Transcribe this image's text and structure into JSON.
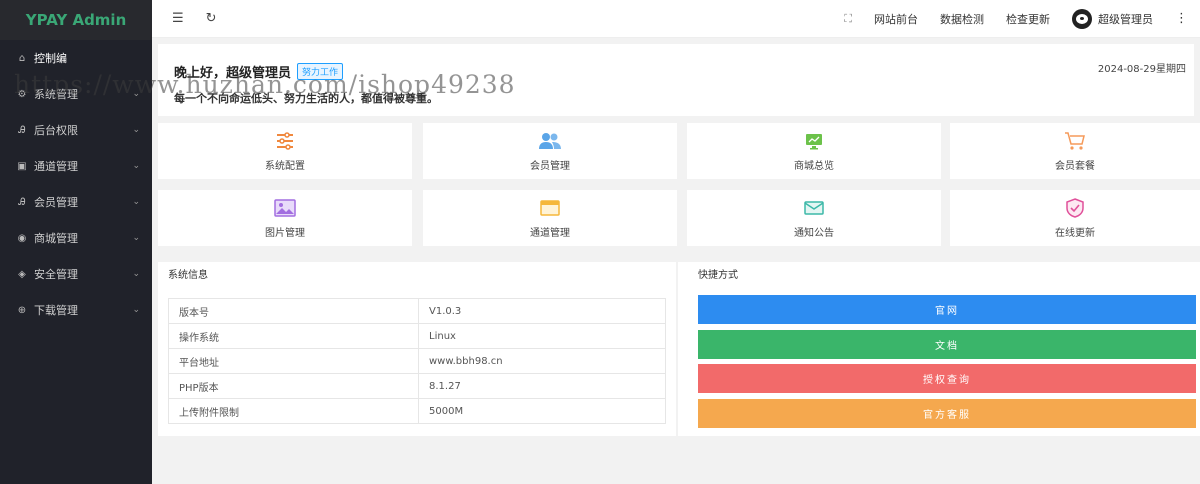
{
  "sidebar": {
    "brand": "YPAY Admin",
    "items": [
      {
        "label": "控制编",
        "icon": "home-icon",
        "glyph": "⌂",
        "has_arrow": false
      },
      {
        "label": "系统管理",
        "icon": "gear-icon",
        "glyph": "⚙",
        "has_arrow": true
      },
      {
        "label": "后台权限",
        "icon": "user-icon",
        "glyph": "Ꭿ",
        "has_arrow": true
      },
      {
        "label": "通道管理",
        "icon": "channel-icon",
        "glyph": "▣",
        "has_arrow": true
      },
      {
        "label": "会员管理",
        "icon": "member-icon",
        "glyph": "Ꭿ",
        "has_arrow": true
      },
      {
        "label": "商城管理",
        "icon": "shop-icon",
        "glyph": "◉",
        "has_arrow": true
      },
      {
        "label": "安全管理",
        "icon": "shield-icon",
        "glyph": "◈",
        "has_arrow": true
      },
      {
        "label": "下载管理",
        "icon": "download-icon",
        "glyph": "⊕",
        "has_arrow": true
      }
    ],
    "arrow_glyph": "⌄"
  },
  "header": {
    "menu_toggle_glyph": "☰",
    "refresh_glyph": "↻",
    "fullscreen_glyph": "⛶",
    "links": [
      "网站前台",
      "数据检测",
      "检查更新"
    ],
    "username": "超级管理员",
    "more_glyph": "⋮"
  },
  "welcome": {
    "greeting": "晚上好，超级管理员",
    "tag": "努力工作",
    "motto": "每一个不向命运低头、努力生活的人，都值得被尊重。",
    "date": "2024-08-29星期四"
  },
  "tiles": [
    {
      "label": "系统配置",
      "icon": "sliders-icon",
      "color": "#f0883e"
    },
    {
      "label": "会员管理",
      "icon": "users-icon",
      "color": "#5aa5e8"
    },
    {
      "label": "商城总览",
      "icon": "monitor-icon",
      "color": "#6cc24a"
    },
    {
      "label": "会员套餐",
      "icon": "cart-icon",
      "color": "#f59a5a"
    },
    {
      "label": "图片管理",
      "icon": "image-icon",
      "color": "#a26ee0"
    },
    {
      "label": "通道管理",
      "icon": "window-icon",
      "color": "#f5b73a"
    },
    {
      "label": "通知公告",
      "icon": "mail-icon",
      "color": "#3cb8a8"
    },
    {
      "label": "在线更新",
      "icon": "shield-check-icon",
      "color": "#e0509a"
    }
  ],
  "system_info": {
    "title": "系统信息",
    "rows": [
      {
        "key": "版本号",
        "value": "V1.0.3"
      },
      {
        "key": "操作系统",
        "value": "Linux"
      },
      {
        "key": "平台地址",
        "value": "www.bbh98.cn"
      },
      {
        "key": "PHP版本",
        "value": "8.1.27"
      },
      {
        "key": "上传附件限制",
        "value": "5000M"
      }
    ]
  },
  "shortcuts": {
    "title": "快捷方式",
    "buttons": [
      {
        "label": "官网",
        "color": "#2d8cf0"
      },
      {
        "label": "文档",
        "color": "#3ab56a"
      },
      {
        "label": "授权查询",
        "color": "#f26a6a"
      },
      {
        "label": "官方客服",
        "color": "#f5a84e"
      }
    ]
  },
  "watermark": "https://www.huzhan.com/ishop49238"
}
